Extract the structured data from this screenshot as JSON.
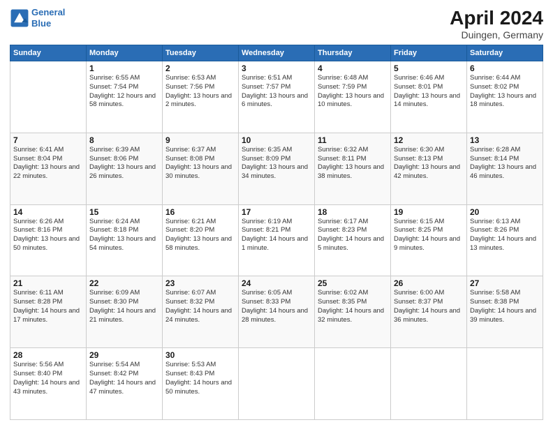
{
  "header": {
    "logo_line1": "General",
    "logo_line2": "Blue",
    "month": "April 2024",
    "location": "Duingen, Germany"
  },
  "weekdays": [
    "Sunday",
    "Monday",
    "Tuesday",
    "Wednesday",
    "Thursday",
    "Friday",
    "Saturday"
  ],
  "weeks": [
    [
      {
        "day": "",
        "sunrise": "",
        "sunset": "",
        "daylight": ""
      },
      {
        "day": "1",
        "sunrise": "Sunrise: 6:55 AM",
        "sunset": "Sunset: 7:54 PM",
        "daylight": "Daylight: 12 hours and 58 minutes."
      },
      {
        "day": "2",
        "sunrise": "Sunrise: 6:53 AM",
        "sunset": "Sunset: 7:56 PM",
        "daylight": "Daylight: 13 hours and 2 minutes."
      },
      {
        "day": "3",
        "sunrise": "Sunrise: 6:51 AM",
        "sunset": "Sunset: 7:57 PM",
        "daylight": "Daylight: 13 hours and 6 minutes."
      },
      {
        "day": "4",
        "sunrise": "Sunrise: 6:48 AM",
        "sunset": "Sunset: 7:59 PM",
        "daylight": "Daylight: 13 hours and 10 minutes."
      },
      {
        "day": "5",
        "sunrise": "Sunrise: 6:46 AM",
        "sunset": "Sunset: 8:01 PM",
        "daylight": "Daylight: 13 hours and 14 minutes."
      },
      {
        "day": "6",
        "sunrise": "Sunrise: 6:44 AM",
        "sunset": "Sunset: 8:02 PM",
        "daylight": "Daylight: 13 hours and 18 minutes."
      }
    ],
    [
      {
        "day": "7",
        "sunrise": "Sunrise: 6:41 AM",
        "sunset": "Sunset: 8:04 PM",
        "daylight": "Daylight: 13 hours and 22 minutes."
      },
      {
        "day": "8",
        "sunrise": "Sunrise: 6:39 AM",
        "sunset": "Sunset: 8:06 PM",
        "daylight": "Daylight: 13 hours and 26 minutes."
      },
      {
        "day": "9",
        "sunrise": "Sunrise: 6:37 AM",
        "sunset": "Sunset: 8:08 PM",
        "daylight": "Daylight: 13 hours and 30 minutes."
      },
      {
        "day": "10",
        "sunrise": "Sunrise: 6:35 AM",
        "sunset": "Sunset: 8:09 PM",
        "daylight": "Daylight: 13 hours and 34 minutes."
      },
      {
        "day": "11",
        "sunrise": "Sunrise: 6:32 AM",
        "sunset": "Sunset: 8:11 PM",
        "daylight": "Daylight: 13 hours and 38 minutes."
      },
      {
        "day": "12",
        "sunrise": "Sunrise: 6:30 AM",
        "sunset": "Sunset: 8:13 PM",
        "daylight": "Daylight: 13 hours and 42 minutes."
      },
      {
        "day": "13",
        "sunrise": "Sunrise: 6:28 AM",
        "sunset": "Sunset: 8:14 PM",
        "daylight": "Daylight: 13 hours and 46 minutes."
      }
    ],
    [
      {
        "day": "14",
        "sunrise": "Sunrise: 6:26 AM",
        "sunset": "Sunset: 8:16 PM",
        "daylight": "Daylight: 13 hours and 50 minutes."
      },
      {
        "day": "15",
        "sunrise": "Sunrise: 6:24 AM",
        "sunset": "Sunset: 8:18 PM",
        "daylight": "Daylight: 13 hours and 54 minutes."
      },
      {
        "day": "16",
        "sunrise": "Sunrise: 6:21 AM",
        "sunset": "Sunset: 8:20 PM",
        "daylight": "Daylight: 13 hours and 58 minutes."
      },
      {
        "day": "17",
        "sunrise": "Sunrise: 6:19 AM",
        "sunset": "Sunset: 8:21 PM",
        "daylight": "Daylight: 14 hours and 1 minute."
      },
      {
        "day": "18",
        "sunrise": "Sunrise: 6:17 AM",
        "sunset": "Sunset: 8:23 PM",
        "daylight": "Daylight: 14 hours and 5 minutes."
      },
      {
        "day": "19",
        "sunrise": "Sunrise: 6:15 AM",
        "sunset": "Sunset: 8:25 PM",
        "daylight": "Daylight: 14 hours and 9 minutes."
      },
      {
        "day": "20",
        "sunrise": "Sunrise: 6:13 AM",
        "sunset": "Sunset: 8:26 PM",
        "daylight": "Daylight: 14 hours and 13 minutes."
      }
    ],
    [
      {
        "day": "21",
        "sunrise": "Sunrise: 6:11 AM",
        "sunset": "Sunset: 8:28 PM",
        "daylight": "Daylight: 14 hours and 17 minutes."
      },
      {
        "day": "22",
        "sunrise": "Sunrise: 6:09 AM",
        "sunset": "Sunset: 8:30 PM",
        "daylight": "Daylight: 14 hours and 21 minutes."
      },
      {
        "day": "23",
        "sunrise": "Sunrise: 6:07 AM",
        "sunset": "Sunset: 8:32 PM",
        "daylight": "Daylight: 14 hours and 24 minutes."
      },
      {
        "day": "24",
        "sunrise": "Sunrise: 6:05 AM",
        "sunset": "Sunset: 8:33 PM",
        "daylight": "Daylight: 14 hours and 28 minutes."
      },
      {
        "day": "25",
        "sunrise": "Sunrise: 6:02 AM",
        "sunset": "Sunset: 8:35 PM",
        "daylight": "Daylight: 14 hours and 32 minutes."
      },
      {
        "day": "26",
        "sunrise": "Sunrise: 6:00 AM",
        "sunset": "Sunset: 8:37 PM",
        "daylight": "Daylight: 14 hours and 36 minutes."
      },
      {
        "day": "27",
        "sunrise": "Sunrise: 5:58 AM",
        "sunset": "Sunset: 8:38 PM",
        "daylight": "Daylight: 14 hours and 39 minutes."
      }
    ],
    [
      {
        "day": "28",
        "sunrise": "Sunrise: 5:56 AM",
        "sunset": "Sunset: 8:40 PM",
        "daylight": "Daylight: 14 hours and 43 minutes."
      },
      {
        "day": "29",
        "sunrise": "Sunrise: 5:54 AM",
        "sunset": "Sunset: 8:42 PM",
        "daylight": "Daylight: 14 hours and 47 minutes."
      },
      {
        "day": "30",
        "sunrise": "Sunrise: 5:53 AM",
        "sunset": "Sunset: 8:43 PM",
        "daylight": "Daylight: 14 hours and 50 minutes."
      },
      {
        "day": "",
        "sunrise": "",
        "sunset": "",
        "daylight": ""
      },
      {
        "day": "",
        "sunrise": "",
        "sunset": "",
        "daylight": ""
      },
      {
        "day": "",
        "sunrise": "",
        "sunset": "",
        "daylight": ""
      },
      {
        "day": "",
        "sunrise": "",
        "sunset": "",
        "daylight": ""
      }
    ]
  ]
}
